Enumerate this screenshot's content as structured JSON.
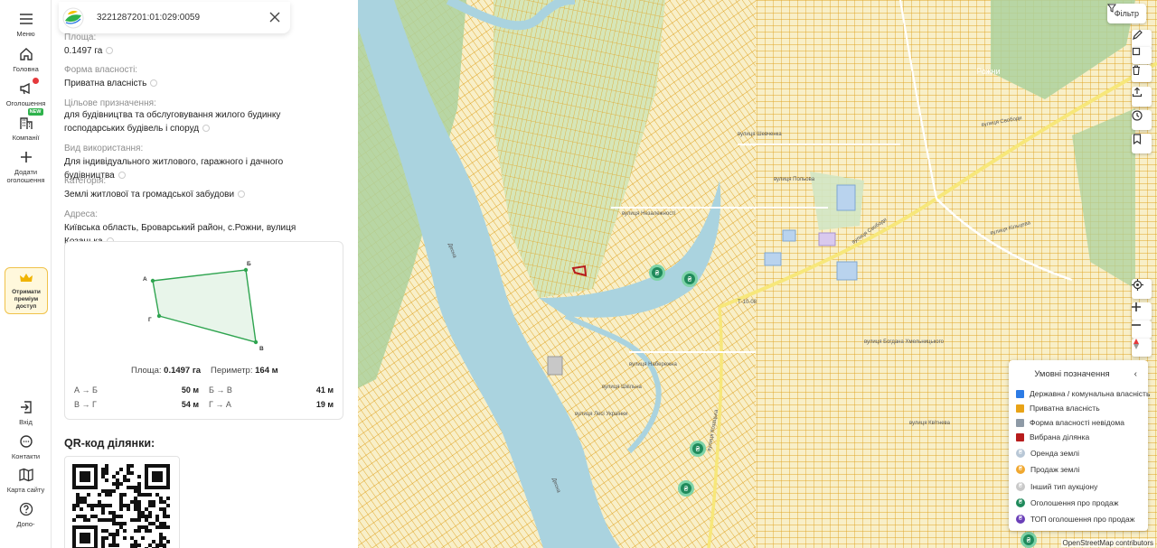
{
  "nav": {
    "menu": "Меню",
    "home": "Головна",
    "ads": "Оголошення",
    "companies": "Компанії",
    "companies_badge": "NEW",
    "add_ad": "Додати оголошення",
    "premium": "Отримати преміум доступ",
    "login": "Вхід",
    "contacts": "Контакти",
    "sitemap": "Карта сайту",
    "help": "Допо-"
  },
  "parcel": {
    "cadastral_number": "3221287201:01:029:0059",
    "area_label": "Площа:",
    "area_value": "0.1497 га",
    "ownership_label": "Форма власності:",
    "ownership_value": "Приватна власність",
    "purpose_label": "Цільове призначення:",
    "purpose_value": "для будівництва та обслуговування жилого будинку господарських будівель і споруд",
    "usage_label": "Вид використання:",
    "usage_value": "Для індивідуального житлового, гаражного і дачного будівництва",
    "category_label": "Категорія:",
    "category_value": "Землі житлової та громадської забудови",
    "address_label": "Адреса:",
    "address_value": "Київська область, Броварський район, с.Рожни, вулиця Козацька"
  },
  "shape": {
    "vertices": {
      "a": "А",
      "b": "Б",
      "v": "В",
      "g": "Г"
    },
    "area_label": "Площа:",
    "area_value": "0.1497 га",
    "perimeter_label": "Периметр:",
    "perimeter_value": "164 м",
    "sides": [
      {
        "label": "А → Б",
        "value": "50 м"
      },
      {
        "label": "Б → В",
        "value": "41 м"
      },
      {
        "label": "В → Г",
        "value": "54 м"
      },
      {
        "label": "Г → А",
        "value": "19 м"
      }
    ]
  },
  "qr": {
    "title": "QR-код ділянки:"
  },
  "map": {
    "filter_label": "Фільтр",
    "place_name": "Рожни",
    "streets": {
      "s1": "вулиця Свободи",
      "s2": "вулиця Свободи",
      "s3": "вулиця Незалежності",
      "s4": "вулиця Шевченка",
      "s5": "вулиця Козацька",
      "s6": "вулиця Польова",
      "s7": "вулиця Лесі Українки",
      "s8": "вулиця Шкільна",
      "s9": "вулиця Богдана Хмельницького",
      "s10": "вулиця Кільцева",
      "s11": "вулиця Набережна",
      "s12": "Т-10-08",
      "s13": "Десна",
      "s14": "Десна",
      "s15": "вулиця Квітнева"
    },
    "attribution": "OpenStreetMap contributors"
  },
  "legend": {
    "title": "Умовні позначення",
    "items": [
      {
        "label": "Державна / комунальна власність",
        "color": "#2c7be5"
      },
      {
        "label": "Приватна власність",
        "color": "#e8a317"
      },
      {
        "label": "Форма власності невідома",
        "color": "#8e9aa6"
      },
      {
        "label": "Вибрана ділянка",
        "color": "#b71c1c"
      },
      {
        "label": "Оренда землі",
        "color": "#b8c7d6"
      },
      {
        "label": "Продаж землі",
        "color": "#f0a830"
      },
      {
        "label": "Інший тип аукціону",
        "color": "#c9c9c9"
      },
      {
        "label": "Оголошення про продаж",
        "color": "#1f8a5b"
      },
      {
        "label": "ТОП оголошення про продаж",
        "color": "#6a3fb8"
      }
    ]
  },
  "colors": {
    "map_background": "#f8efc8",
    "parcel_line": "#e0a424",
    "water": "#aad3df",
    "forest": "#add19e",
    "road": "#f7e77a",
    "shape_stroke": "#2ea44f",
    "shape_fill": "#e8f5ea"
  }
}
